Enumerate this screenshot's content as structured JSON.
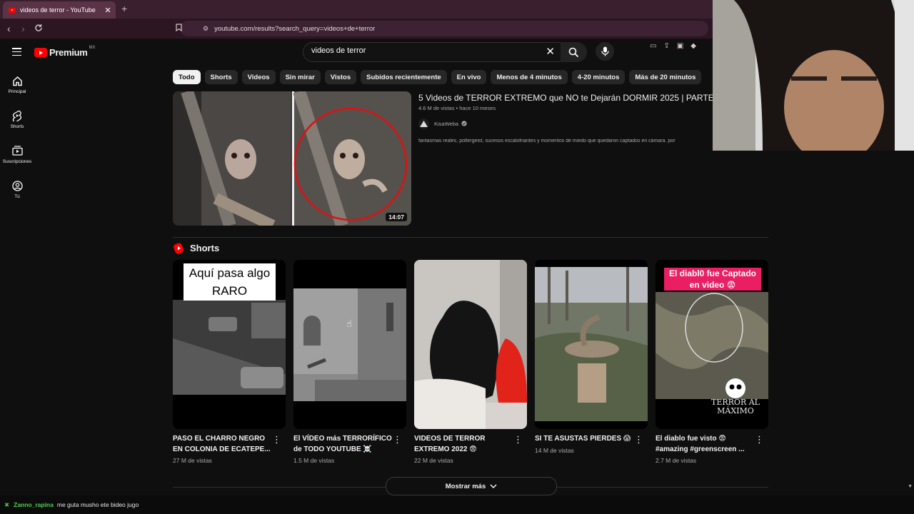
{
  "browser": {
    "tab_title": "videos de terror - YouTube",
    "tab_close": "✕",
    "new_tab": "+",
    "url": "youtube.com/results?search_query=videos+de+terror"
  },
  "header": {
    "logo_text": "Premium",
    "country_code": "MX",
    "search_value": "videos de terror"
  },
  "sidebar": {
    "items": [
      {
        "label": "Principal",
        "icon": "home-icon"
      },
      {
        "label": "Shorts",
        "icon": "shorts-icon"
      },
      {
        "label": "Suscripciones",
        "icon": "subscriptions-icon"
      },
      {
        "label": "Tú",
        "icon": "you-icon"
      }
    ]
  },
  "chips": [
    "Todo",
    "Shorts",
    "Videos",
    "Sin mirar",
    "Vistos",
    "Subidos recientemente",
    "En vivo",
    "Menos de 4 minutos",
    "4-20 minutos",
    "Más de 20 minutos"
  ],
  "video": {
    "title": "5 Videos de TERROR EXTREMO que NO te Dejarán DORMIR 2025 | PARTE 8",
    "meta": "4.6 M de vistas • hace 10 meses",
    "channel": "KisaWeba",
    "description": "fantasmas reales, poltergeist, sucesos escalofriantes y momentos de miedo que quedaron captados en cámara. por",
    "duration": "14:07"
  },
  "shorts": {
    "heading": "Shorts",
    "items": [
      {
        "title": "PASO EL CHARRO NEGRO EN COLONIA DE ECATEPE...",
        "views": "27 M de vistas",
        "overlay": "Aquí pasa algo RARO"
      },
      {
        "title": "El VÍDEO más TERRORÍFICO de TODO YOUTUBE ☠️",
        "views": "1.5 M de vistas"
      },
      {
        "title": "VIDEOS DE TERROR EXTREMO 2022 😨",
        "views": "22 M de vistas"
      },
      {
        "title": "SI TE ASUSTAS PIERDES 😱",
        "views": "14 M de vistas"
      },
      {
        "title": "El diablo fue visto 😨 #amazing #greenscreen ...",
        "views": "2.7 M de vistas",
        "overlay": "El diabl0 fue Captado en video 😨",
        "watermark": "TERROR AL MÁXIMO"
      }
    ],
    "show_more": "Mostrar más"
  },
  "chat": {
    "user": "Zanno_rapina",
    "message": "me guta musho ete bideo jugo"
  },
  "colors": {
    "background": "#0f0f0f",
    "accent": "#ff0000",
    "chip": "#272727"
  }
}
